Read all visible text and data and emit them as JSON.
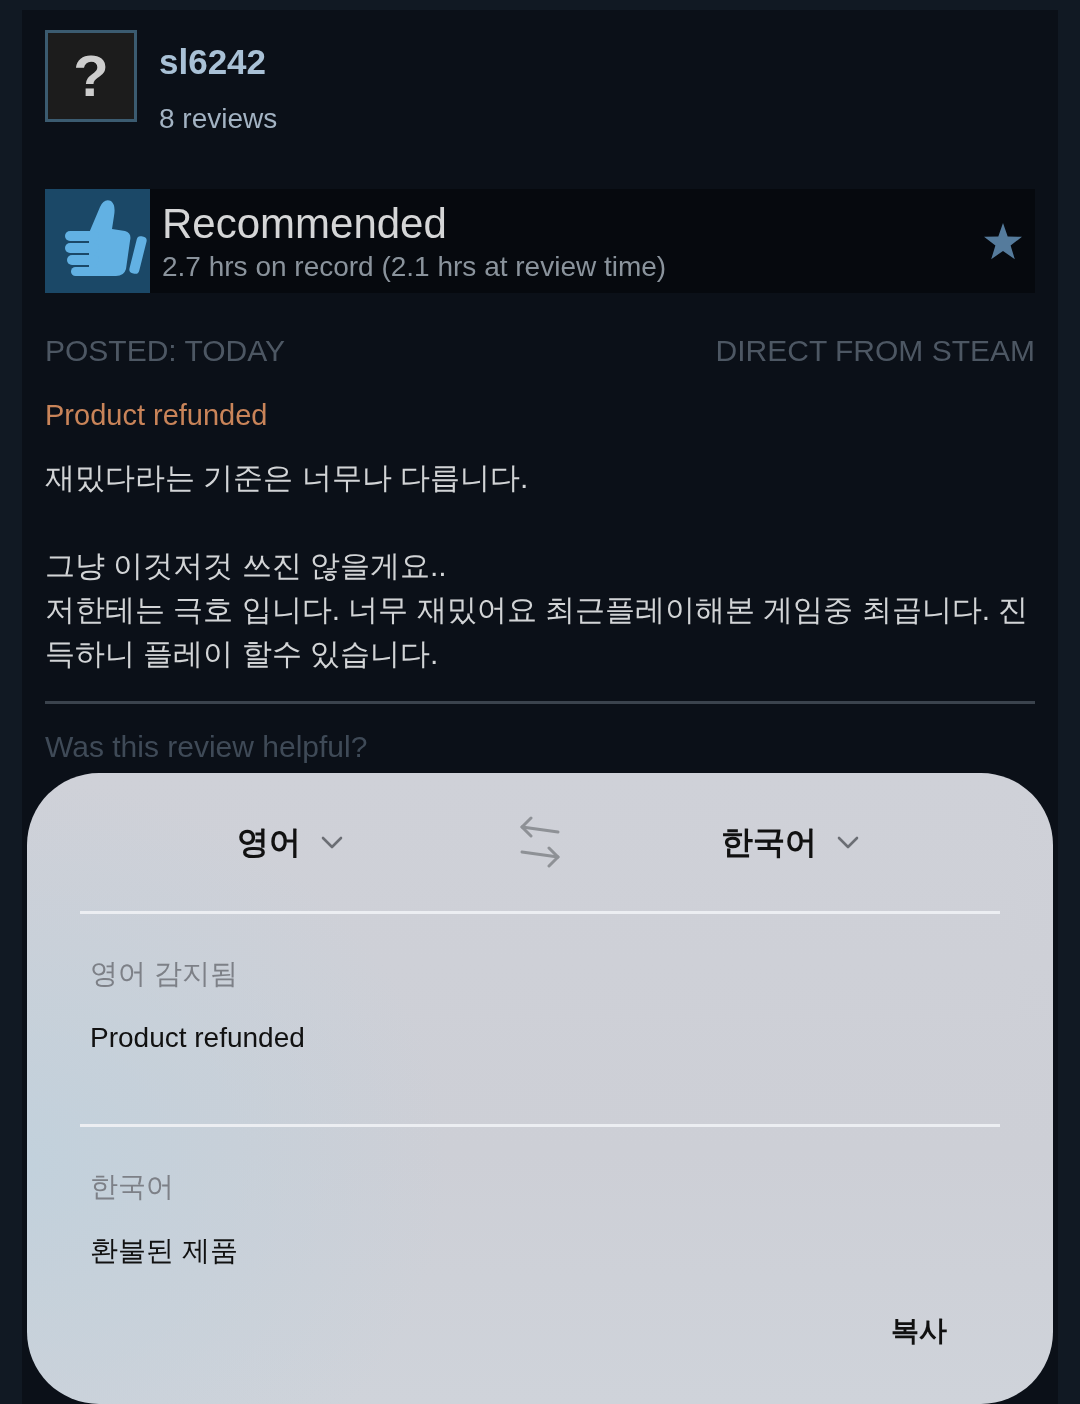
{
  "review": {
    "author": {
      "avatar_symbol": "?",
      "name": "sl6242",
      "review_count": "8 reviews"
    },
    "verdict": {
      "kind": "recommended",
      "label": "Recommended",
      "playtime": "2.7 hrs on record (2.1 hrs at review time)"
    },
    "posted": "POSTED: TODAY",
    "source": "DIRECT FROM STEAM",
    "notice": "Product refunded",
    "paragraphs": [
      "재밌다라는 기준은 너무나 다릅니다.",
      "그냥 이것저것 쓰진 않을게요..\n저한테는 극호 입니다. 너무 재밌어요 최근플레이해본 게임중 최곱니다. 진득하니 플레이 할수 있습니다."
    ],
    "helpful_prompt": "Was this review helpful?"
  },
  "translate_sheet": {
    "source_language": "영어",
    "target_language": "한국어",
    "source_label": "영어 감지됨",
    "source_text": "Product refunded",
    "target_label": "한국어",
    "target_text": "환불된 제품",
    "copy_button": "복사"
  }
}
